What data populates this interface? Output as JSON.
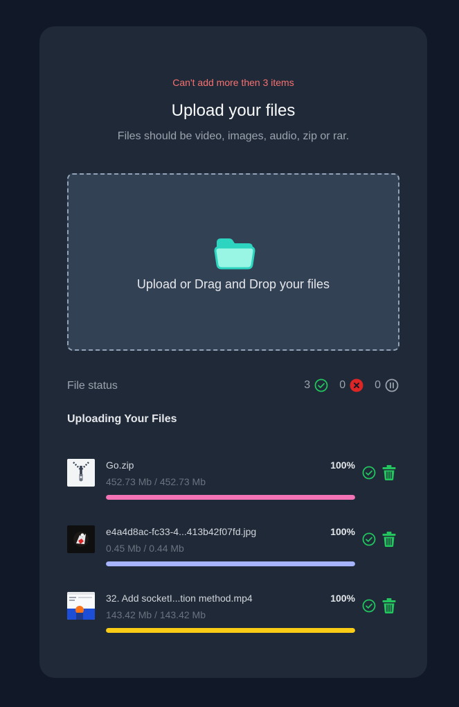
{
  "header": {
    "error": "Can't add more then 3 items",
    "title": "Upload your files",
    "subtitle": "Files should be video, images, audio, zip or rar."
  },
  "dropzone": {
    "text": "Upload or Drag and Drop your files",
    "icon": "folder-icon",
    "icon_color": "#5eead4"
  },
  "status": {
    "label": "File status",
    "completed": "3",
    "failed": "0",
    "paused": "0",
    "colors": {
      "completed": "#22c55e",
      "failed": "#dc2626",
      "paused": "#9ca3af"
    }
  },
  "section_title": "Uploading Your Files",
  "files": [
    {
      "name": "Go.zip",
      "size": "452.73 Mb / 452.73 Mb",
      "percent": "100%",
      "progress": 1.0,
      "color": "#f472b6",
      "thumb": "zip-icon"
    },
    {
      "name": "e4a4d8ac-fc33-4...413b42f07fd.jpg",
      "size": "0.45 Mb / 0.44 Mb",
      "percent": "100%",
      "progress": 1.0,
      "color": "#a5b4fc",
      "thumb": "image-thumbnail"
    },
    {
      "name": "32. Add socketI...tion method.mp4",
      "size": "143.42 Mb / 143.42 Mb",
      "percent": "100%",
      "progress": 1.0,
      "color": "#facc15",
      "thumb": "video-thumbnail"
    }
  ]
}
